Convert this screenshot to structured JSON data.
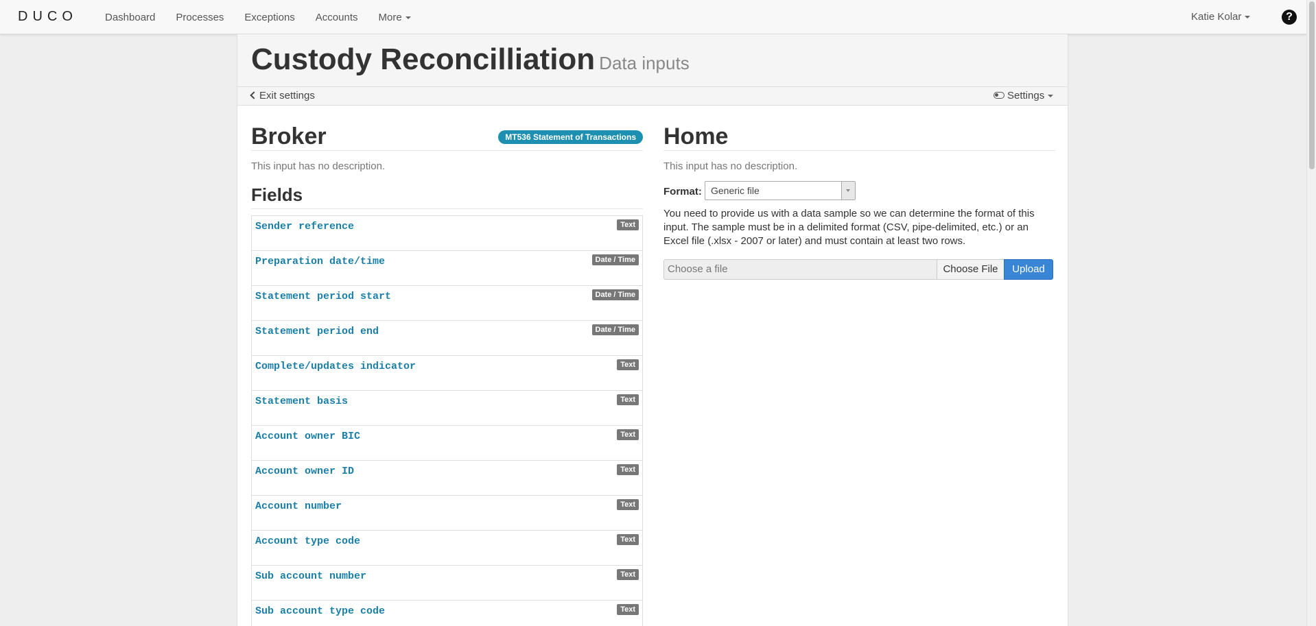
{
  "navbar": {
    "logo": "DUCO",
    "items": [
      {
        "label": "Dashboard"
      },
      {
        "label": "Processes"
      },
      {
        "label": "Exceptions"
      },
      {
        "label": "Accounts"
      },
      {
        "label": "More"
      }
    ],
    "user": "Katie Kolar",
    "help": "?"
  },
  "page": {
    "title": "Custody Reconcilliation",
    "subtitle": "Data inputs",
    "exit_settings": "Exit settings",
    "settings": "Settings"
  },
  "broker": {
    "title": "Broker",
    "badge": "MT536 Statement of Transactions",
    "description": "This input has no description.",
    "fields_title": "Fields",
    "fields": [
      {
        "name": "Sender reference",
        "type": "Text"
      },
      {
        "name": "Preparation date/time",
        "type": "Date / Time"
      },
      {
        "name": "Statement period start",
        "type": "Date / Time"
      },
      {
        "name": "Statement period end",
        "type": "Date / Time"
      },
      {
        "name": "Complete/updates indicator",
        "type": "Text"
      },
      {
        "name": "Statement basis",
        "type": "Text"
      },
      {
        "name": "Account owner BIC",
        "type": "Text"
      },
      {
        "name": "Account owner ID",
        "type": "Text"
      },
      {
        "name": "Account number",
        "type": "Text"
      },
      {
        "name": "Account type code",
        "type": "Text"
      },
      {
        "name": "Sub account number",
        "type": "Text"
      },
      {
        "name": "Sub account type code",
        "type": "Text"
      }
    ]
  },
  "home": {
    "title": "Home",
    "description": "This input has no description.",
    "format_label": "Format:",
    "format_value": "Generic file",
    "info": "You need to provide us with a data sample so we can determine the format of this input. The sample must be in a delimited format (CSV, pipe-delimited, etc.) or an Excel file (.xlsx - 2007 or later) and must contain at least two rows.",
    "file_placeholder": "Choose a file",
    "choose_button": "Choose File",
    "upload_button": "Upload"
  },
  "colors": {
    "accent": "#1d8fb0",
    "field_name": "#1a7fa8",
    "primary_button": "#3a86d6",
    "type_label": "#777777"
  }
}
